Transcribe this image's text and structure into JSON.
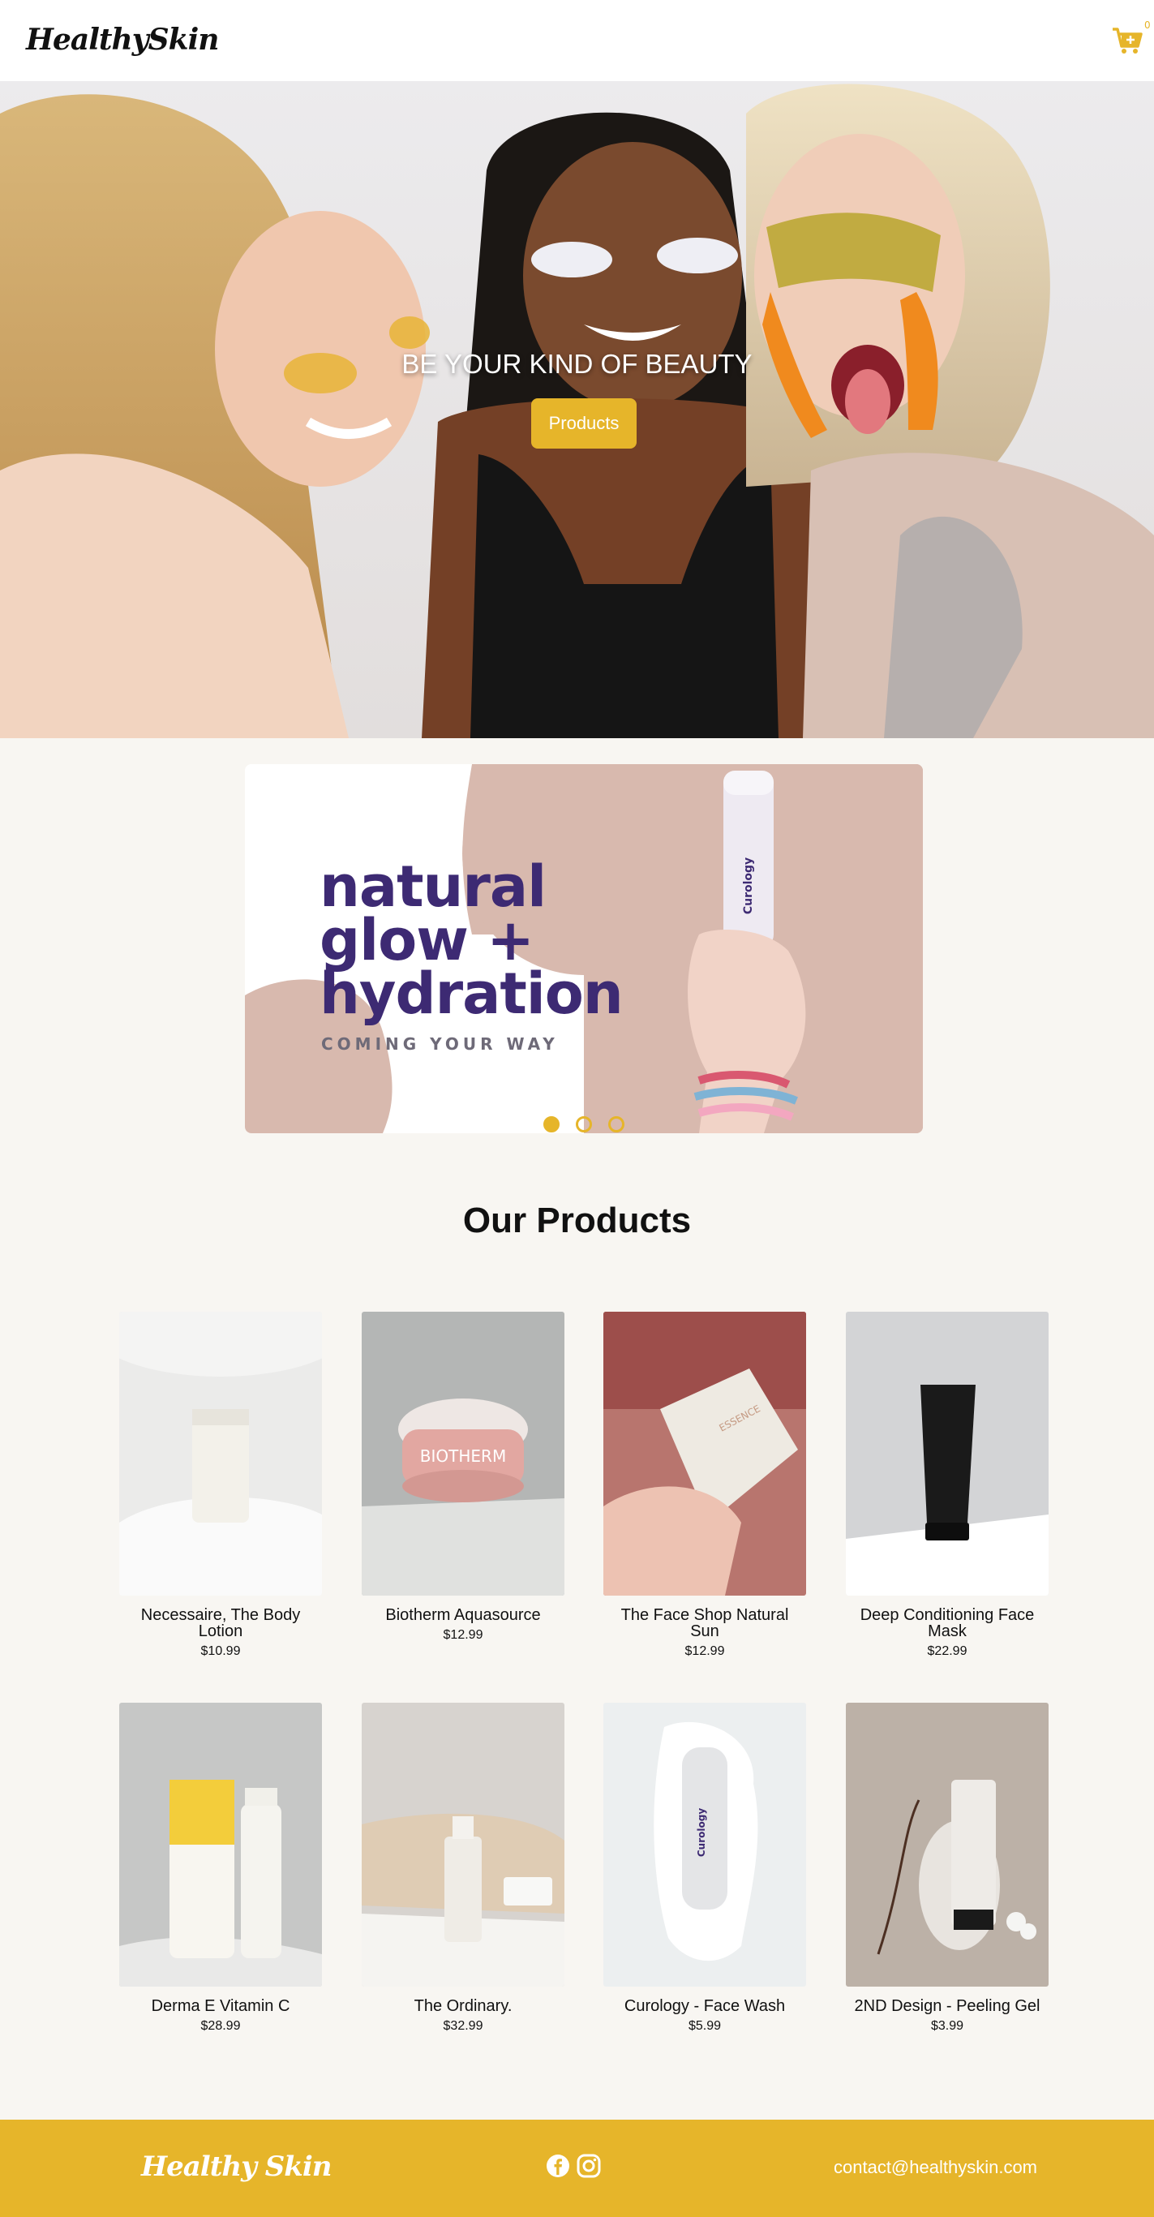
{
  "header": {
    "logo": "HealthySkin",
    "cart_icon": "cart-icon",
    "cart_count": "0"
  },
  "hero": {
    "title": "BE YOUR KIND OF BEAUTY",
    "button_label": "Products"
  },
  "carousel": {
    "headline_line1": "natural",
    "headline_line2": "glow +",
    "headline_line3": "hydration",
    "subheadline": "COMING YOUR WAY",
    "bottle_label": "Curology",
    "slides": 3,
    "active_slide": 1
  },
  "products_section": {
    "title": "Our Products",
    "items": [
      {
        "name": "Necessaire, The Body Lotion",
        "price": "$10.99"
      },
      {
        "name": "Biotherm Aquasource",
        "price": "$12.99"
      },
      {
        "name": "The Face Shop Natural Sun",
        "price": "$12.99"
      },
      {
        "name": "Deep Conditioning Face Mask",
        "price": "$22.99"
      },
      {
        "name": "Derma E Vitamin C",
        "price": "$28.99"
      },
      {
        "name": "The Ordinary.",
        "price": "$32.99"
      },
      {
        "name": "Curology - Face Wash",
        "price": "$5.99"
      },
      {
        "name": "2ND Design - Peeling Gel",
        "price": "$3.99"
      }
    ]
  },
  "footer": {
    "logo": "Healthy Skin",
    "social_icons": [
      "facebook-icon",
      "instagram-icon"
    ],
    "email": "contact@healthyskin.com"
  },
  "colors": {
    "accent": "#e6b52a",
    "headline": "#3d2a73",
    "page_bg": "#f8f6f2"
  }
}
